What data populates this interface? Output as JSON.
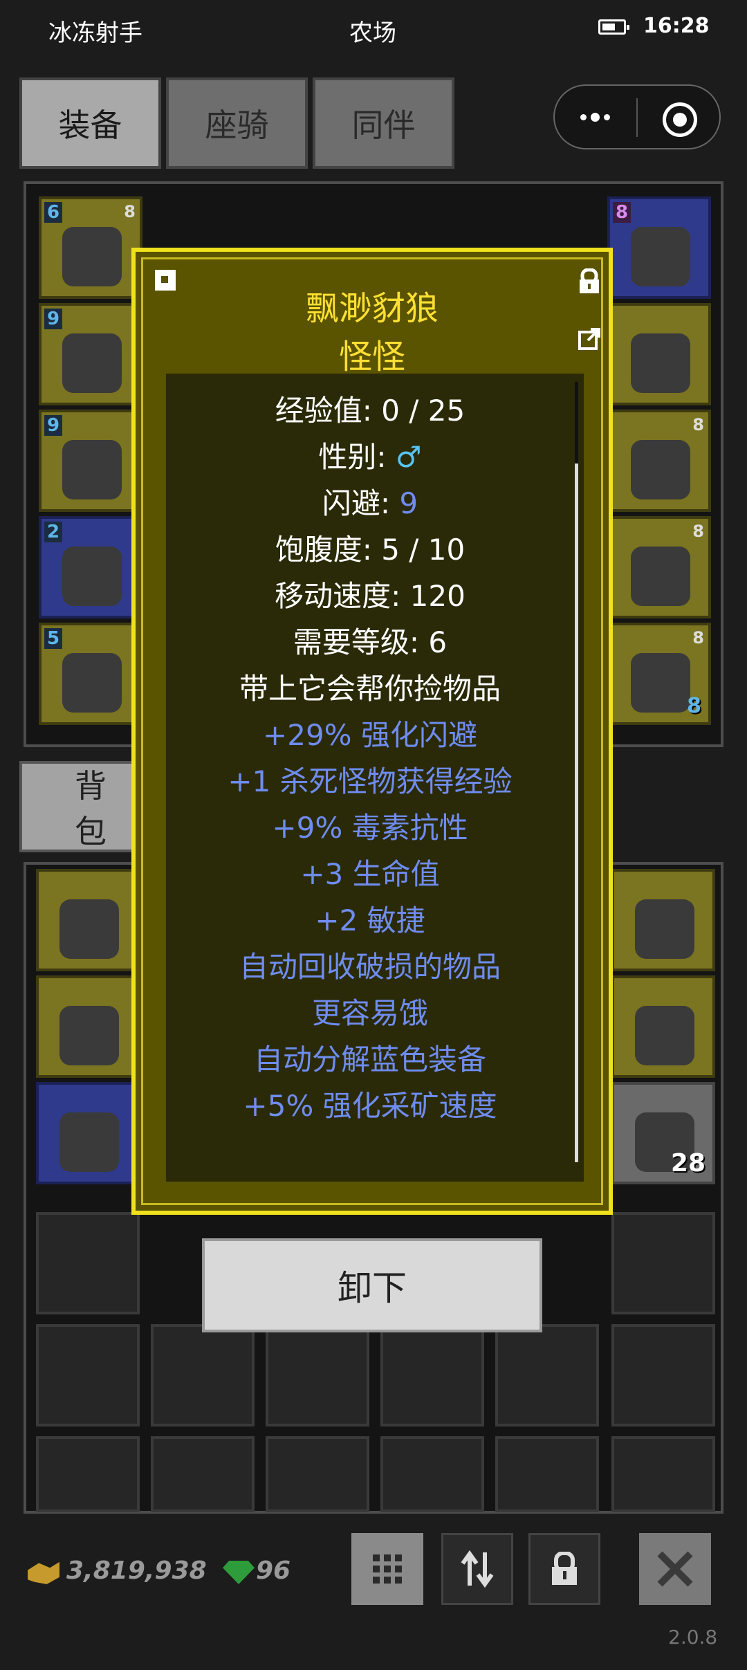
{
  "status_bar": {
    "left_label": "冰冻射手",
    "center_label": "农场",
    "time": "16:28"
  },
  "tabs": [
    {
      "label": "装备",
      "active": true
    },
    {
      "label": "座骑",
      "active": false
    },
    {
      "label": "同伴",
      "active": false
    }
  ],
  "equipment_slots": {
    "left": [
      {
        "num": "6",
        "lvl": "8"
      },
      {
        "num": "9",
        "lvl": ""
      },
      {
        "num": "9",
        "lvl": ""
      },
      {
        "num": "2",
        "lvl": ""
      },
      {
        "num": "5",
        "lvl": ""
      }
    ],
    "right": [
      {
        "num": "8",
        "lvl": ""
      },
      {
        "num": "",
        "lvl": ""
      },
      {
        "num": "",
        "lvl": "8"
      },
      {
        "num": "",
        "lvl": "8"
      },
      {
        "num": "",
        "lvl": "8",
        "qty": "8"
      }
    ]
  },
  "backpack_tab": {
    "label": "背包"
  },
  "modal": {
    "title": "飘渺豺狼",
    "subtitle": "怪怪",
    "stats": [
      {
        "label": "经验值: 0 / 25",
        "style": "white"
      },
      {
        "label": "性别: ",
        "value": "♂",
        "style": "male"
      },
      {
        "label": "闪避: ",
        "value": "9",
        "style": "blue-value"
      },
      {
        "label": "饱腹度: 5 / 10",
        "style": "white"
      },
      {
        "label": "移动速度: 120",
        "style": "white"
      },
      {
        "label": "需要等级: 6",
        "style": "white"
      },
      {
        "label": "带上它会帮你捡物品",
        "style": "white"
      },
      {
        "label": "+29% 强化闪避",
        "style": "blue"
      },
      {
        "label": "+1 杀死怪物获得经验",
        "style": "blue"
      },
      {
        "label": "+9% 毒素抗性",
        "style": "blue"
      },
      {
        "label": "+3 生命值",
        "style": "blue"
      },
      {
        "label": "+2 敏捷",
        "style": "blue"
      },
      {
        "label": "自动回收破损的物品",
        "style": "blue"
      },
      {
        "label": "更容易饿",
        "style": "blue"
      },
      {
        "label": "自动分解蓝色装备",
        "style": "blue"
      },
      {
        "label": "+5% 强化采矿速度",
        "style": "blue"
      }
    ]
  },
  "unequip_button": {
    "label": "卸下"
  },
  "backpack_item_qty": "28",
  "bottom_bar": {
    "gold": "3,819,938",
    "gems": "96",
    "version": "2.0.8"
  },
  "colors": {
    "modal_border": "#f0e11e",
    "title": "#ffe033",
    "bonus_text": "#6f8cf0",
    "male_symbol": "#59c2f2"
  }
}
